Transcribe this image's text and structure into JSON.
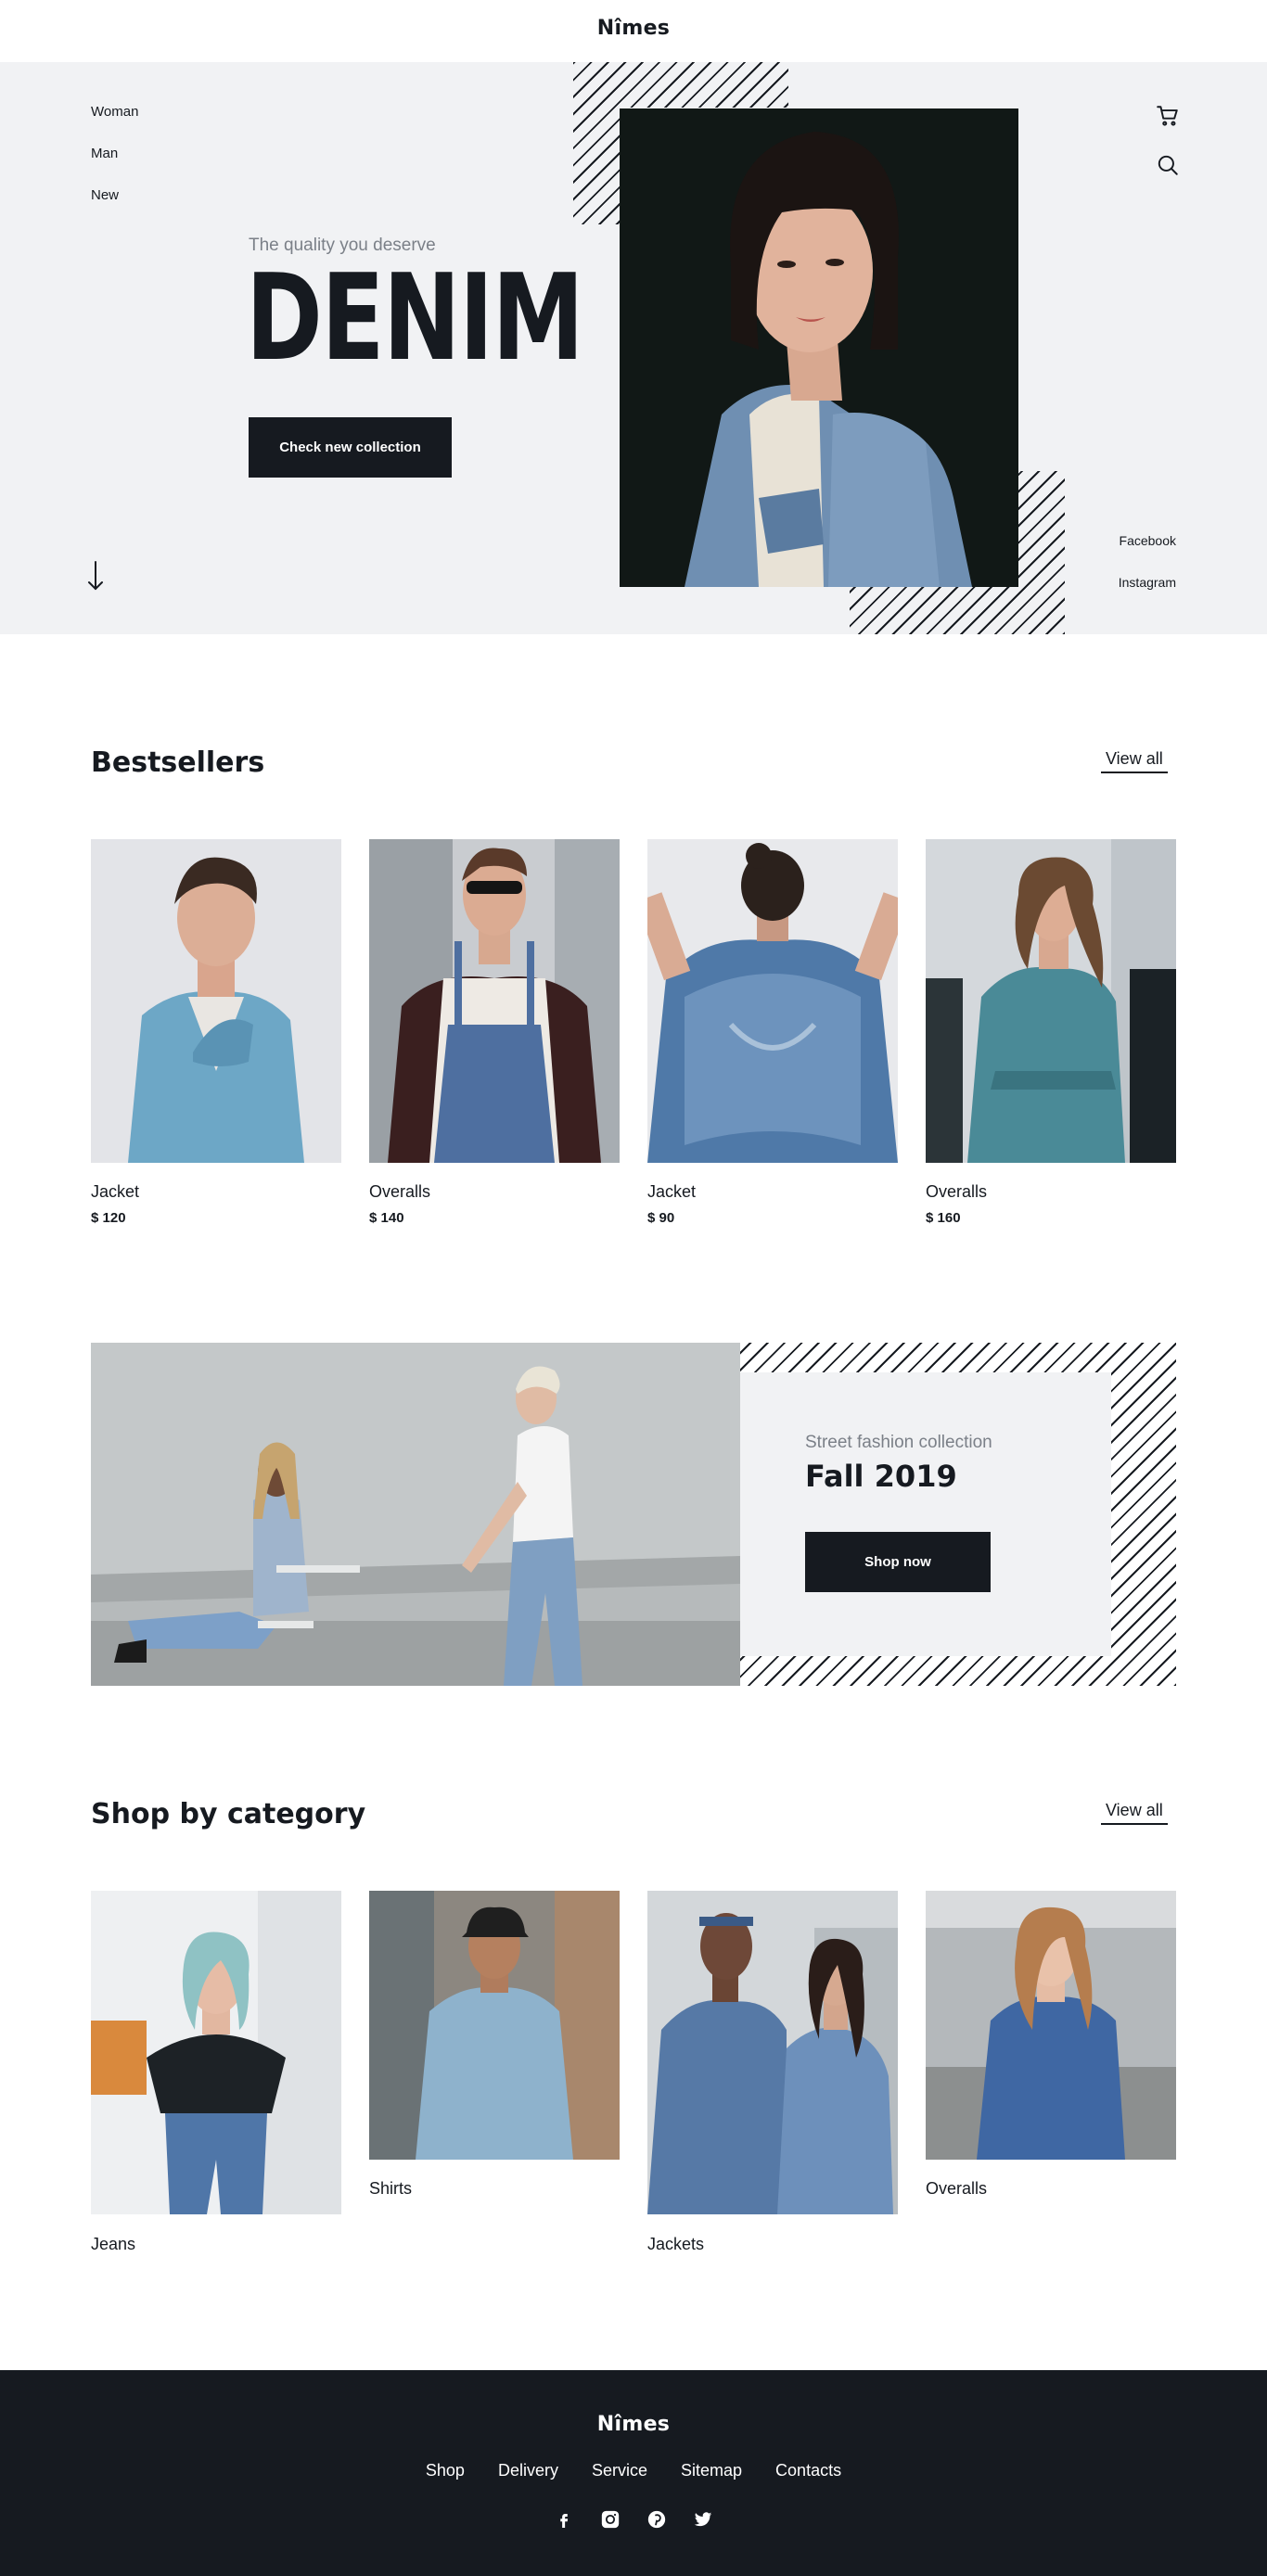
{
  "brand": {
    "logo": "Nîmes"
  },
  "header": {
    "nav": [
      "Woman",
      "Man",
      "New"
    ],
    "cart_icon": "cart-icon",
    "search_icon": "search-icon"
  },
  "hero": {
    "tagline": "The quality you deserve",
    "title": "DENIM",
    "cta": "Check new collection",
    "scroll_icon": "arrow-down-icon",
    "social": [
      "Facebook",
      "Instagram"
    ]
  },
  "bestsellers": {
    "title": "Bestsellers",
    "view_all": "View all",
    "products": [
      {
        "name": "Jacket",
        "price": "$ 120"
      },
      {
        "name": "Overalls",
        "price": "$ 140"
      },
      {
        "name": "Jacket",
        "price": "$ 90"
      },
      {
        "name": "Overalls",
        "price": "$ 160"
      }
    ]
  },
  "promo": {
    "subtitle": "Street fashion collection",
    "title": "Fall 2019",
    "cta": "Shop now"
  },
  "categories": {
    "title": "Shop by category",
    "view_all": "View all",
    "items": [
      {
        "name": "Jeans"
      },
      {
        "name": "Shirts"
      },
      {
        "name": "Jackets"
      },
      {
        "name": "Overalls"
      }
    ]
  },
  "footer": {
    "logo": "Nîmes",
    "links": [
      "Shop",
      "Delivery",
      "Service",
      "Sitemap",
      "Contacts"
    ],
    "social_icons": [
      "facebook-icon",
      "instagram-icon",
      "pinterest-icon",
      "twitter-icon"
    ]
  },
  "colors": {
    "dark": "#161a20",
    "hero_bg": "#f1f2f4",
    "muted": "#7b8088",
    "denim": "#5a80a8"
  }
}
